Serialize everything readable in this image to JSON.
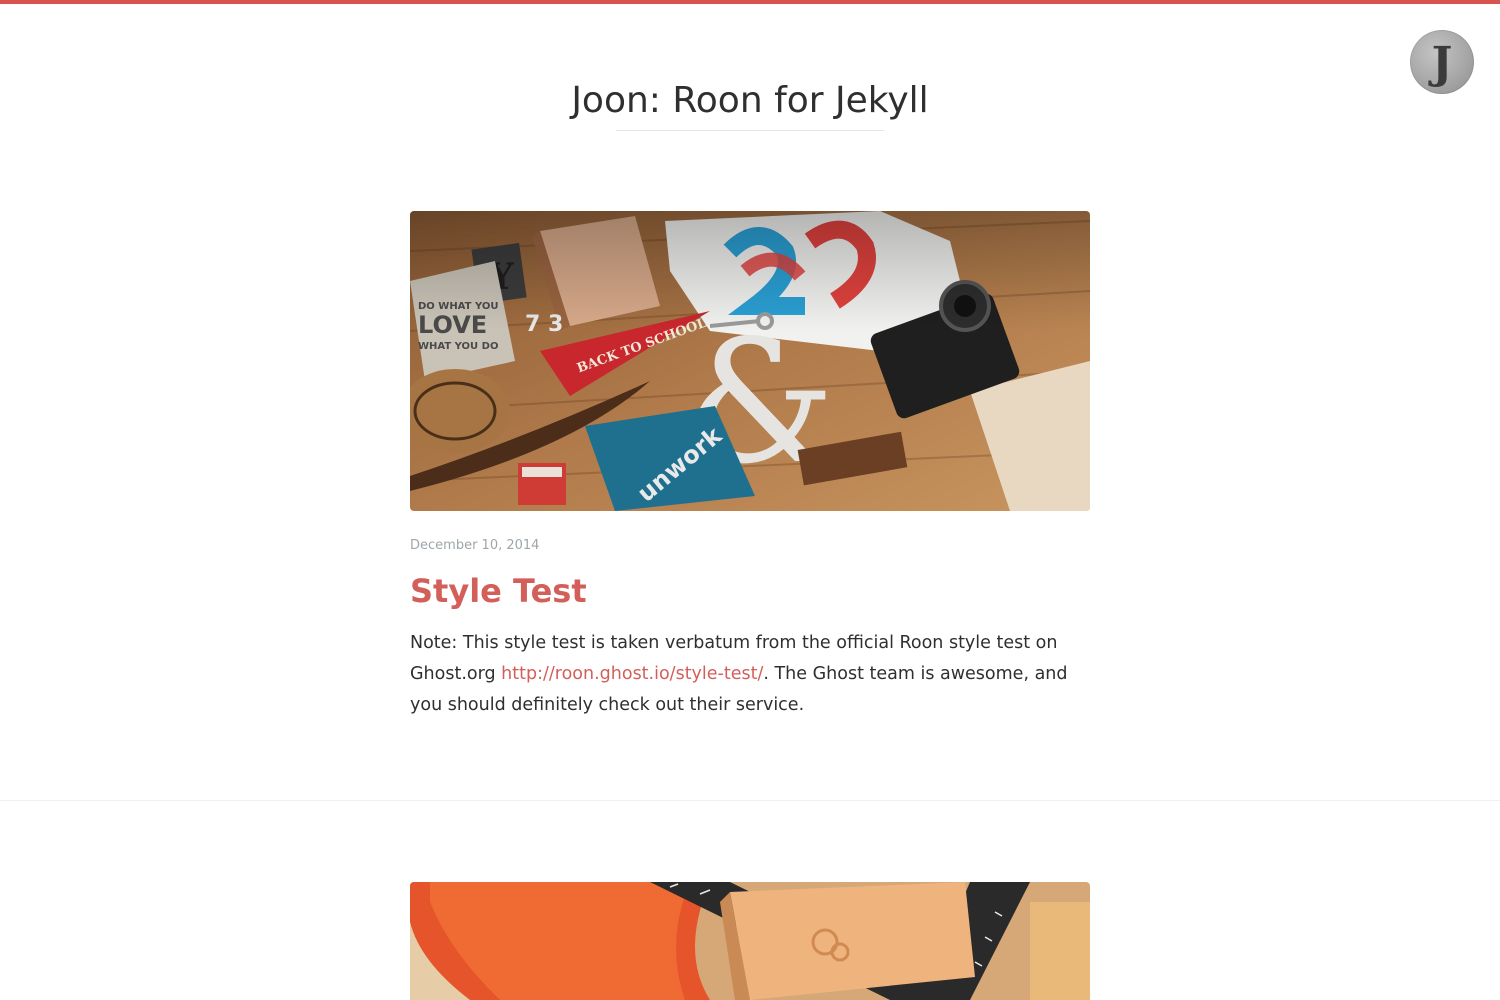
{
  "header": {
    "avatar_letter": "J",
    "blog_title": "Joon: Roon for Jekyll"
  },
  "posts": [
    {
      "image": "photo-desk-flatlay",
      "date": "December 10, 2014",
      "title": "Style Test",
      "excerpt_before": " Note: This style test is taken verbatum from the official Roon style test on Ghost.org ",
      "excerpt_link": "http://roon.ghost.io/style-test/",
      "excerpt_after": ". The Ghost team is awesome, and you should definitely check out their service."
    },
    {
      "image": "photo-orange-chair-notebook"
    }
  ],
  "colors": {
    "accent": "#d35f5a",
    "top_bar": "#d9534f",
    "date": "#9ea6ab",
    "text": "#2f2f2f"
  }
}
